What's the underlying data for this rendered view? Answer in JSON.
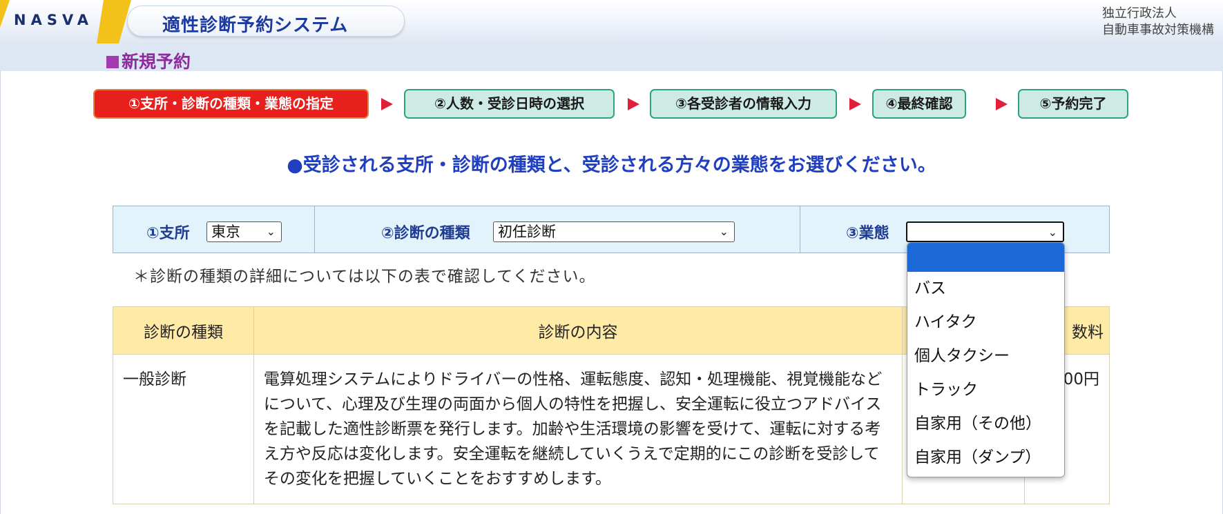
{
  "header": {
    "logo": "NASVA",
    "system_title": "適性診断予約システム",
    "org_line1": "独立行政法人",
    "org_line2": "自動車事故対策機構"
  },
  "page": {
    "title": "新規予約"
  },
  "steps": [
    {
      "label": "①支所・診断の種類・業態の指定",
      "active": true
    },
    {
      "label": "②人数・受診日時の選択",
      "active": false
    },
    {
      "label": "③各受診者の情報入力",
      "active": false
    },
    {
      "label": "④最終確認",
      "active": false
    },
    {
      "label": "⑤予約完了",
      "active": false
    }
  ],
  "instruction": "●受診される支所・診断の種類と、受診される方々の業態をお選びください。",
  "selectors": {
    "branch_label": "①支所",
    "branch_value": "東京",
    "type_label": "②診断の種類",
    "type_value": "初任診断",
    "business_label": "③業態",
    "business_value": ""
  },
  "note": "＊診断の種類の詳細については以下の表で確認してください。",
  "table": {
    "headers": [
      "診断の種類",
      "診断の内容",
      "数料"
    ],
    "rows": [
      {
        "type": "一般診断",
        "description": "電算処理システムによりドライバーの性格、運転態度、認知・処理機能、視覚機能などについて、心理及び生理の両面から個人の特性を把握し、安全運転に役立つアドバイスを記載した適性診断票を発行します。加齢や生活環境の影響を受けて、運転に対する考え方や反応は変化します。安全運転を継続していくうえで定期的にこの診断を受診してその変化を把握していくことをおすすめします。",
        "fee": "00円"
      }
    ]
  },
  "dropdown": {
    "options": [
      "",
      "バス",
      "ハイタク",
      "個人タクシー",
      "トラック",
      "自家用（その他）",
      "自家用（ダンプ）"
    ],
    "selected_index": 0
  },
  "colors": {
    "active_step": "#e8201d",
    "inactive_step": "#cdebe4",
    "instruction": "#1f3fc0",
    "table_header": "#ffeaa6",
    "selected_option": "#1b68d6"
  }
}
